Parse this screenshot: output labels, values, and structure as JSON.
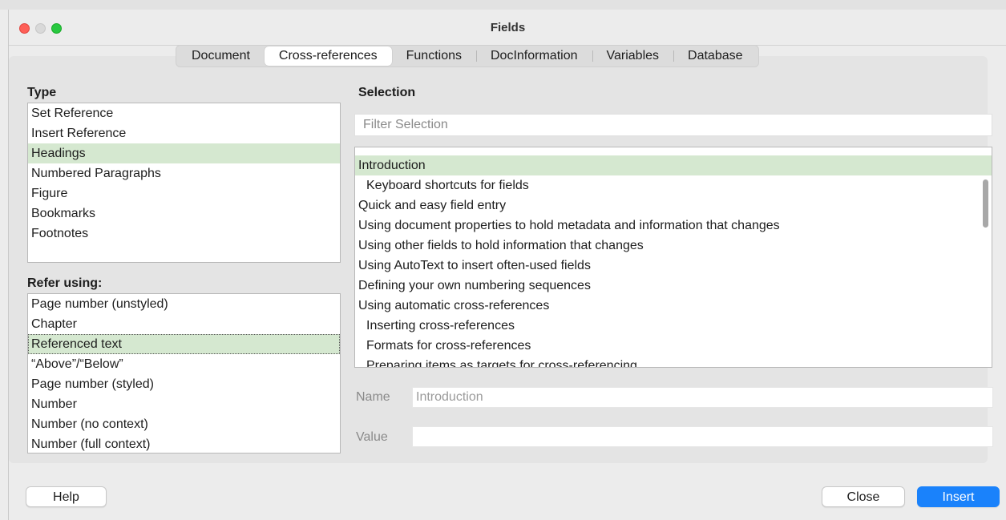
{
  "window": {
    "title": "Fields"
  },
  "tabs": [
    {
      "label": "Document"
    },
    {
      "label": "Cross-references"
    },
    {
      "label": "Functions"
    },
    {
      "label": "DocInformation"
    },
    {
      "label": "Variables"
    },
    {
      "label": "Database"
    }
  ],
  "type": {
    "label": "Type",
    "items": [
      "Set Reference",
      "Insert Reference",
      "Headings",
      "Numbered Paragraphs",
      "Figure",
      "Bookmarks",
      "Footnotes"
    ],
    "selected": "Headings"
  },
  "refer": {
    "label": "Refer using:",
    "items": [
      "Page number (unstyled)",
      "Chapter",
      "Referenced text",
      "“Above”/“Below”",
      "Page number (styled)",
      "Number",
      "Number (no context)",
      "Number (full context)"
    ],
    "selected": "Referenced text"
  },
  "selection": {
    "label": "Selection",
    "filter_placeholder": "Filter Selection",
    "items": [
      {
        "text": "Introduction",
        "indent": false
      },
      {
        "text": "Keyboard shortcuts for fields",
        "indent": true
      },
      {
        "text": "Quick and easy field entry",
        "indent": false
      },
      {
        "text": "Using document properties to hold metadata and information that changes",
        "indent": false
      },
      {
        "text": "Using other fields to hold information that changes",
        "indent": false
      },
      {
        "text": "Using AutoText to insert often-used fields",
        "indent": false
      },
      {
        "text": "Defining your own numbering sequences",
        "indent": false
      },
      {
        "text": "Using automatic cross-references",
        "indent": false
      },
      {
        "text": "Inserting cross-references",
        "indent": true
      },
      {
        "text": "Formats for cross-references",
        "indent": true
      },
      {
        "text": "Preparing items as targets for cross-referencing",
        "indent": true
      }
    ],
    "selected": "Introduction"
  },
  "name_field": {
    "label": "Name",
    "value": "Introduction"
  },
  "value_field": {
    "label": "Value",
    "value": ""
  },
  "buttons": {
    "help": "Help",
    "close": "Close",
    "insert": "Insert"
  },
  "colors": {
    "selected_bg": "#d5e8d0",
    "insert_button": "#1a82fb"
  }
}
